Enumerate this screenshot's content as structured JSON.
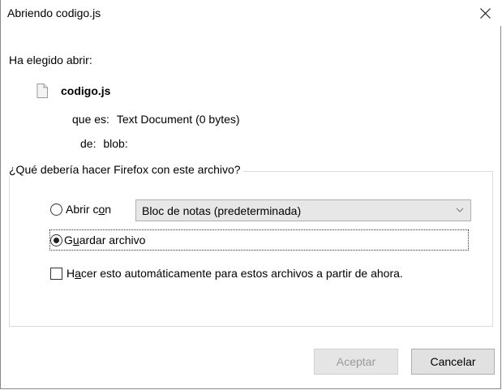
{
  "window": {
    "title": "Abriendo codigo.js",
    "close_glyph": "✕"
  },
  "intro": "Ha elegido abrir:",
  "file": {
    "name": "codigo.js",
    "icon": "document-icon",
    "type_label": "que es:",
    "type_value": "Text Document (0 bytes)",
    "from_label": "de:",
    "from_value": "blob:"
  },
  "action_group": {
    "legend": "¿Qué debería hacer Firefox con este archivo?",
    "open_with": {
      "label_pre": "Abrir c",
      "label_accel": "o",
      "label_post": "n",
      "checked": false,
      "app_selected": "Bloc de notas (predeterminada)"
    },
    "save": {
      "label_pre": "G",
      "label_accel": "u",
      "label_post": "ardar archivo",
      "checked": true
    },
    "auto": {
      "label_pre": "H",
      "label_accel": "a",
      "label_post": "cer esto automáticamente para estos archivos a partir de ahora.",
      "checked": false
    }
  },
  "buttons": {
    "ok": "Aceptar",
    "cancel": "Cancelar"
  }
}
